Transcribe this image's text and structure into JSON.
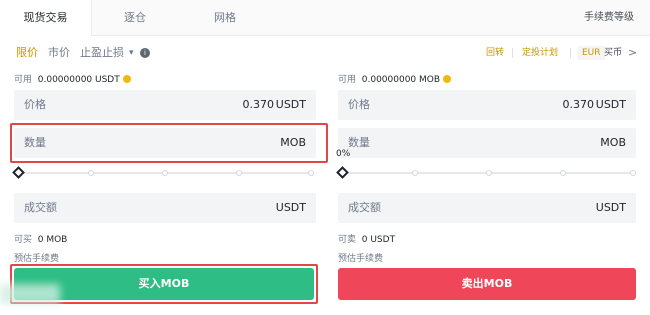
{
  "tabs": {
    "items": [
      "现货交易",
      "逐仓",
      "网格"
    ],
    "right_link": "手续费等级"
  },
  "order_types": {
    "limit": "限价",
    "market": "市价",
    "stop": "止盈止损",
    "stop_caret": "▾",
    "info": "i"
  },
  "right_links": {
    "link1": "回转",
    "link2": "定投计划",
    "currency": "EUR",
    "buy_crypto": "买币",
    "chevron": ">"
  },
  "buy": {
    "avail_label": "可用",
    "avail_value": "0.00000000 USDT",
    "price_label": "价格",
    "price_value": "0.370",
    "price_unit": "USDT",
    "amount_label": "数量",
    "amount_unit": "MOB",
    "total_label": "成交额",
    "total_unit": "USDT",
    "max_label": "可买",
    "max_value": "0 MOB",
    "fee_label": "预估手续费",
    "button": "买入MOB"
  },
  "sell": {
    "avail_label": "可用",
    "avail_value": "0.00000000 MOB",
    "price_label": "价格",
    "price_value": "0.370",
    "price_unit": "USDT",
    "amount_label": "数量",
    "amount_unit": "MOB",
    "slider_percent": "0%",
    "total_label": "成交额",
    "total_unit": "USDT",
    "max_label": "可卖",
    "max_value": "0 USDT",
    "fee_label": "预估手续费",
    "button": "卖出MOB"
  },
  "colors": {
    "accent": "#c99400",
    "buy": "#2ebd85",
    "sell": "#f0465a",
    "highlight_box": "#e04848"
  }
}
